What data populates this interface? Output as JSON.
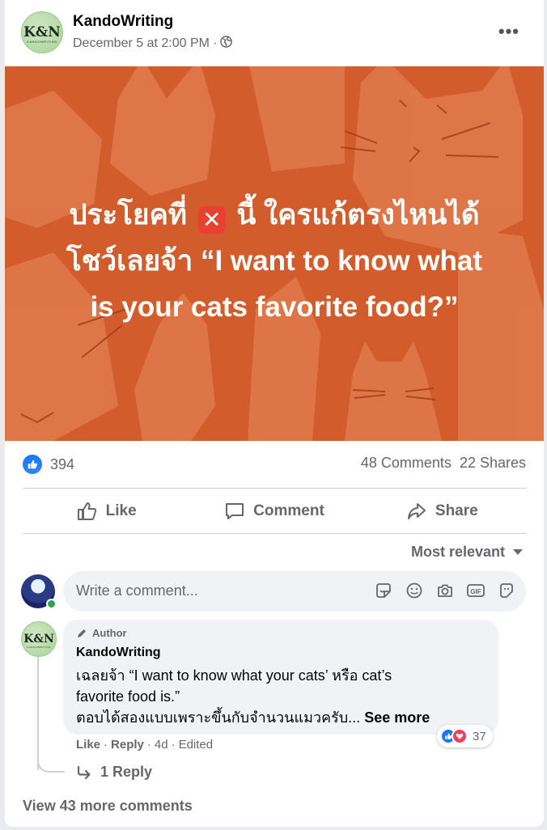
{
  "post": {
    "page_name": "KandoWriting",
    "avatar_monogram": "K&N",
    "avatar_subtitle": "KANDOWRITING",
    "timestamp": "December 5 at 2:00 PM",
    "meta_separator": "·",
    "privacy_icon": "globe-icon",
    "more_icon": "more-options-icon",
    "banner": {
      "line1_before": "ประโยคที่",
      "line1_after": "นี้ ใครแก้ตรงไหนได้",
      "line2": "โชว์เลยจ้า “I want to know what",
      "line3": "is your cats favorite food?”",
      "bg_color": "#d35c2c",
      "cat_color": "#e07a4c"
    }
  },
  "stats": {
    "reaction_count": "394",
    "comments": "48 Comments",
    "shares": "22 Shares"
  },
  "actions": {
    "like": "Like",
    "comment": "Comment",
    "share": "Share"
  },
  "sort": {
    "label": "Most relevant"
  },
  "composer": {
    "placeholder": "Write a comment...",
    "icons": [
      "sticker-icon",
      "emoji-icon",
      "camera-icon",
      "gif-icon",
      "avatar-sticker-icon"
    ]
  },
  "comment": {
    "author_tag": "Author",
    "name": "KandoWriting",
    "text_line1": "เฉลยจ้า “I want to know what your cats’ หรือ cat’s",
    "text_line2": "favorite food is.”",
    "text_line3": "ตอบได้สองแบบเพราะขึ้นกับจำนวนแมวครับ...",
    "see_more": "See more",
    "reaction_count": "37",
    "like": "Like",
    "reply": "Reply",
    "age": "4d",
    "edited": "Edited",
    "dot": "·",
    "replies": "1 Reply"
  },
  "footer": {
    "view_more": "View 43 more comments"
  },
  "colors": {
    "facebook_blue": "#1877f2",
    "love_red": "#f33e58",
    "secondary_text": "#65676b"
  }
}
